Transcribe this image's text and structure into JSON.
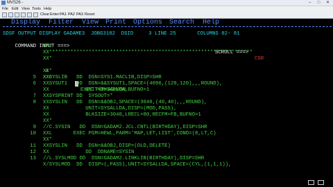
{
  "window": {
    "title": "MVS26 - "
  },
  "menubar": {
    "items": [
      "File",
      "Edit",
      "View",
      "Tools",
      "Help"
    ]
  },
  "toolbar": {
    "labels": [
      "Clear",
      "Enter",
      "PA1",
      "PA2",
      "PA3",
      "Reset"
    ]
  },
  "ispf_menu": {
    "items": [
      "Display",
      "Filter",
      "View",
      "Print",
      "Options",
      "Search",
      "Help"
    ]
  },
  "header": {
    "line1": "SDSF OUTPUT DISPLAY GADAME3  JOBG3182  DSID     3 LINE 25       COLUMNS 02- 81",
    "command_label": "COMMAND INPUT ===>",
    "scroll_label": "SCROLL ===> ",
    "scroll_value": "CSR"
  },
  "lines": [
    {
      "num": "",
      "text": "XX*"
    },
    {
      "num": "",
      "text": "XX*******************************************************************"
    },
    {
      "num": "",
      "text": "XX*"
    },
    {
      "num": "4",
      "label": "XXC",
      "text": "EXEC PGM=ASMA90"
    },
    {
      "num": "",
      "text": "XX*"
    },
    {
      "num": "5",
      "text": "XXSYSLIB   DD  DSN=SYS1.MACLIB,DISP=SHR"
    },
    {
      "num": "6",
      "text": "XXSYSUT1   DD  DSN=&&SYSUT1,SPACE=(4096,(120,120),,,ROUND),"
    },
    {
      "num": "",
      "text": "XX            UNIT=SYSALLDA,BUFNO=1"
    },
    {
      "num": "7",
      "text": "XXSYSPRINT DD  SYSOUT=*"
    },
    {
      "num": "8",
      "text": "XXSYSLIN   DD  DSN=&&OBJ,SPACE=(3040,(40,40),,,ROUND),"
    },
    {
      "num": "",
      "text": "XX            UNIT=SYSALLDA,DISP=(MOD,PASS),"
    },
    {
      "num": "",
      "text": "XX            BLKSIZE=3040,LRECL=80,RECFM=FB,BUFNO=1"
    },
    {
      "num": "",
      "text": "XX*"
    },
    {
      "num": "9",
      "text": "//C.SYSIN   DD  DSN=GADAM2.JCL.CNTL(BIRTHDAY),DISP=SHR"
    },
    {
      "num": "10",
      "text": "XXL       EXEC PGM=HEWL,PARM='MAP,LET,LIST',COND=(8,LT,C)"
    },
    {
      "num": "",
      "text": "XX*"
    },
    {
      "num": "11",
      "text": "XXSYSLIN   DD  DSN=&&OBJ,DISP=(OLD,DELETE)"
    },
    {
      "num": "12",
      "text": "XX            DD  DDNAME=SYSIN"
    },
    {
      "num": "13",
      "text": "//L.SYSLMOD DD  DSN=GADAM2.LINKLIB(BIRTHDAY),DISP=SHR"
    },
    {
      "num": "",
      "text": "X/SYSLMOD  DD  DISP=(,PASS),UNIT=SYSALLDA,SPACE=(CYL,(1,1,1)),"
    }
  ]
}
